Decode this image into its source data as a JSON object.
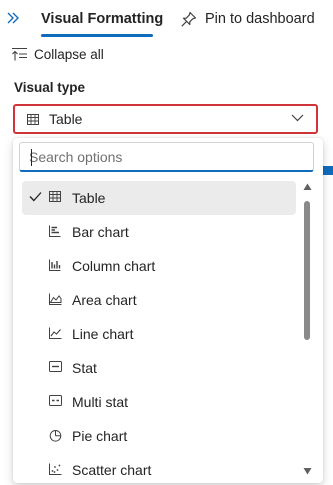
{
  "tabs": {
    "visual_formatting": "Visual Formatting",
    "pin_to_dashboard": "Pin to dashboard"
  },
  "collapse_all": "Collapse all",
  "visual_type": {
    "label": "Visual type",
    "selected": "Table",
    "search_placeholder": "Search options",
    "options": [
      {
        "label": "Table",
        "icon": "table-icon",
        "selected": true
      },
      {
        "label": "Bar chart",
        "icon": "bar-chart-icon",
        "selected": false
      },
      {
        "label": "Column chart",
        "icon": "column-chart-icon",
        "selected": false
      },
      {
        "label": "Area chart",
        "icon": "area-chart-icon",
        "selected": false
      },
      {
        "label": "Line chart",
        "icon": "line-chart-icon",
        "selected": false
      },
      {
        "label": "Stat",
        "icon": "stat-icon",
        "selected": false
      },
      {
        "label": "Multi stat",
        "icon": "multi-stat-icon",
        "selected": false
      },
      {
        "label": "Pie chart",
        "icon": "pie-chart-icon",
        "selected": false
      },
      {
        "label": "Scatter chart",
        "icon": "scatter-chart-icon",
        "selected": false
      }
    ]
  },
  "colors": {
    "accent": "#0f6cbd",
    "error_border": "#d13438",
    "selected_row": "#ebebeb"
  }
}
